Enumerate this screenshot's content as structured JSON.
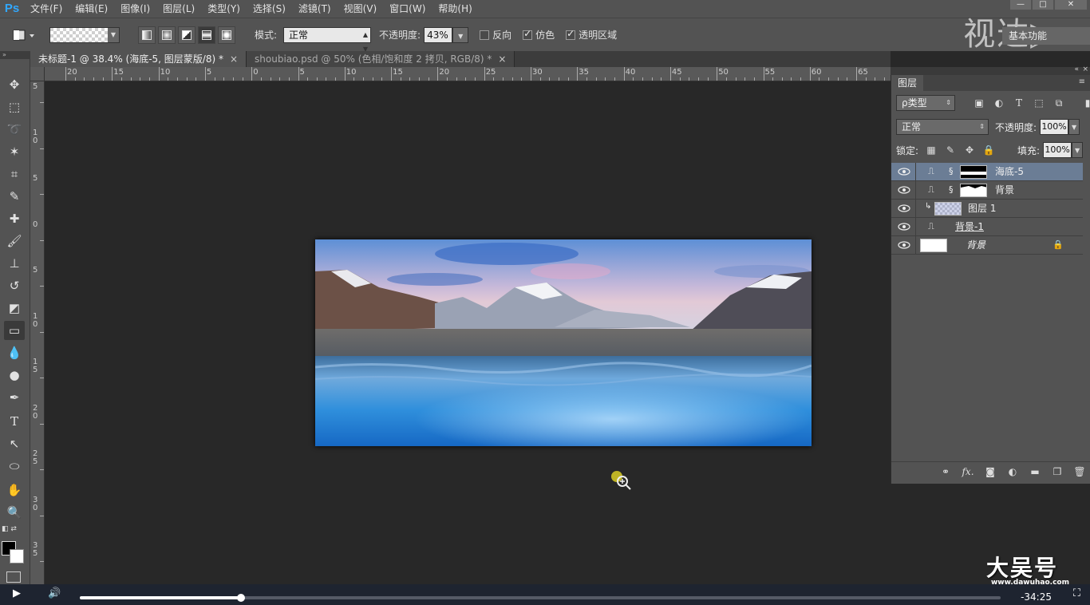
{
  "menubar": {
    "logo": "Ps",
    "items": [
      "文件(F)",
      "编辑(E)",
      "图像(I)",
      "图层(L)",
      "类型(Y)",
      "选择(S)",
      "滤镜(T)",
      "视图(V)",
      "窗口(W)",
      "帮助(H)"
    ],
    "window_controls": [
      "—",
      "□",
      "✕"
    ]
  },
  "options": {
    "mode_label": "模式:",
    "mode_value": "正常",
    "opacity_label": "不透明度:",
    "opacity_value": "43%",
    "reverse_label": "反向",
    "dither_label": "仿色",
    "transparency_label": "透明区域",
    "reverse_checked": false,
    "dither_checked": true,
    "transparency_checked": true,
    "workspace": "基本功能"
  },
  "watermark_top": "视达▷",
  "tabs": [
    {
      "label": "未标题-1 @ 38.4% (海底-5, 图层蒙版/8) *",
      "close": "×",
      "active": true
    },
    {
      "label": "shoubiao.psd @ 50% (色相/饱和度 2 拷贝, RGB/8) *",
      "close": "×",
      "active": false
    }
  ],
  "ruler_h_labels": [
    "20",
    "15",
    "10",
    "5",
    "0",
    "5",
    "10",
    "15",
    "20",
    "25",
    "30",
    "35",
    "40",
    "45",
    "50",
    "55",
    "60",
    "65"
  ],
  "ruler_v_labels": [
    "5",
    "1 0",
    "5",
    "0",
    "5",
    "1 0",
    "1 5",
    "2 0",
    "2 5",
    "3 0",
    "3 5"
  ],
  "layers_panel": {
    "title": "图层",
    "kind_filter": "ρ类型",
    "filter_icons": [
      "image-filter-icon",
      "adjustment-filter-icon",
      "type-filter-icon",
      "shape-filter-icon",
      "smartobject-filter-icon"
    ],
    "blend_mode": "正常",
    "opacity_label": "不透明度:",
    "opacity_value": "100%",
    "lock_label": "锁定:",
    "fill_label": "填充:",
    "fill_value": "100%",
    "layers": [
      {
        "name": "海底-5",
        "selected": true,
        "has_mask": true,
        "thumb": "mask-wave"
      },
      {
        "name": "背景",
        "selected": false,
        "has_mask": true,
        "thumb": "mask-mountain"
      },
      {
        "name": "图层 1",
        "selected": false,
        "has_mask": false,
        "thumb": "checker",
        "clipped": true
      },
      {
        "name": "背景-1",
        "selected": false,
        "has_mask": false,
        "thumb": "none"
      },
      {
        "name": "背景",
        "selected": false,
        "has_mask": false,
        "thumb": "white",
        "locked": true
      }
    ],
    "footer_icons": [
      "link-icon",
      "fx-icon",
      "mask-icon",
      "adjustment-icon",
      "folder-icon",
      "new-layer-icon",
      "trash-icon"
    ]
  },
  "video": {
    "time_remaining": "-34:25",
    "progress": 0.175
  },
  "brand": {
    "name": "大吴号",
    "url": "www.dawuhao.com"
  },
  "colors": {
    "foreground": "#000000",
    "background": "#ffffff",
    "selected_layer": "#6b7d95"
  }
}
